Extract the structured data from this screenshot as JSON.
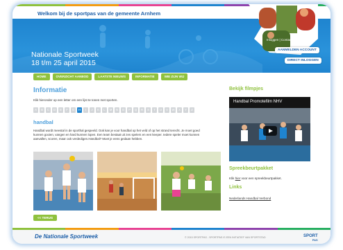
{
  "header": {
    "welcome": "Welkom bij de sportpas van de gemeente Arnhem",
    "banner_title_line1": "Nationale Sportweek",
    "banner_title_line2": "18 t/m 25 april 2015",
    "login_links": "Inloggen | Contact",
    "buttons": {
      "register": "AANMELDEN ACCOUNT",
      "login": "DIRECT INLOGGEN"
    }
  },
  "nav": {
    "items": [
      "HOME",
      "OVERZICHT AANBOD",
      "LAATSTE NIEUWS",
      "INFORMATIE",
      "WIE ZIJN WIJ"
    ]
  },
  "main": {
    "title": "Informatie",
    "intro": "Klik hieronder op een letter om een lijst te tonen met sporten.",
    "letters": [
      "A",
      "B",
      "C",
      "D",
      "E",
      "F",
      "G",
      "H",
      "I",
      "J",
      "K",
      "L",
      "M",
      "N",
      "O",
      "P",
      "Q",
      "R",
      "S",
      "T",
      "U",
      "V",
      "W",
      "X",
      "Y",
      "Z"
    ],
    "active_letter": "H",
    "sport_title": "handbal",
    "description": "Handbal wordt meestal in de sporthal gespeeld. Ook kan je voor handbal op het veld of op het strand terecht. Je moet goed kunnen gooien, vangen en hard kunnen lopen. Een team bestaat uit zes spelers en een keeper. Iedere speler moet kunnen aanvallen, scoren, maar ook verdedigen.Handbal? Moet je eens gedaan hebben.",
    "back_button": "<< TERUG"
  },
  "sidebar": {
    "video_heading": "Bekijk filmpjes",
    "video_title": "Handbal Promotefilm NHV",
    "speech_heading": "Spreekbeurtpakket",
    "speech_text_prefix": "Klik ",
    "speech_link": "hier",
    "speech_text_suffix": " voor een spreekbeurtpakket.",
    "links_heading": "Links",
    "links": [
      "Nederlands Handbal Verbond"
    ]
  },
  "footer": {
    "logo_text": "De Nationale Sportweek",
    "copyright": "© 2015 SPORTPAS - SPORTPAS IS EEN INITIATIEF VAN SPORTSTAD",
    "brand_line1": "SPORT",
    "brand_line2": "PAS"
  },
  "colors": {
    "primary_blue": "#1f84cf",
    "accent_green": "#8fc13d",
    "heading_blue": "#4fa0dc",
    "stripe": [
      "#8fc13d",
      "#f39c12",
      "#e84393",
      "#1f84cf",
      "#8e44ad",
      "#27ae60"
    ]
  }
}
